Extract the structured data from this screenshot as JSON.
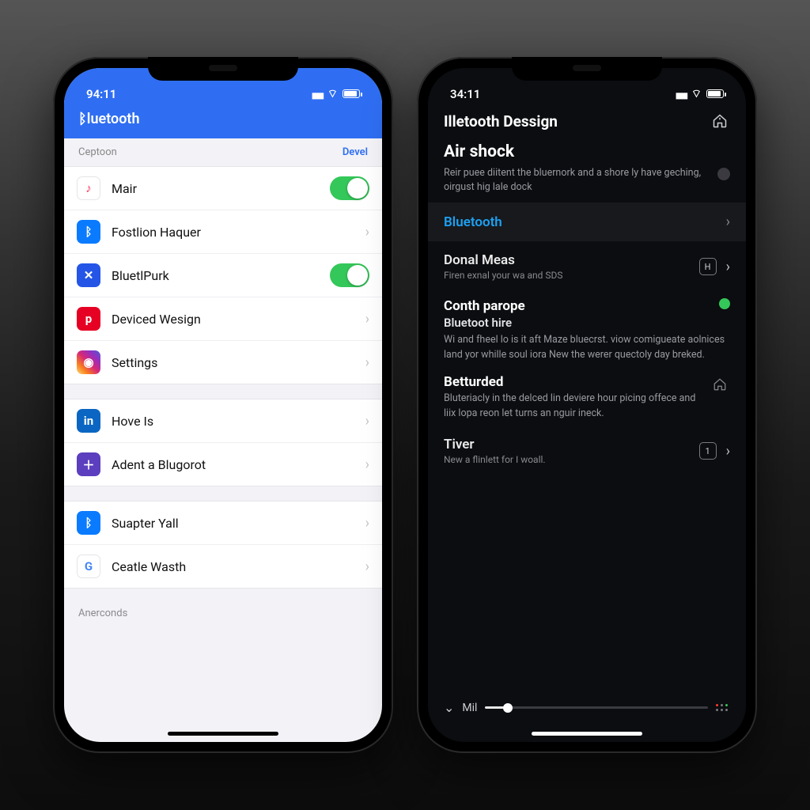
{
  "left": {
    "status": {
      "time": "94:11"
    },
    "header_title": "ᛒluetooth",
    "section_label": "Ceptoon",
    "section_action": "Devel",
    "group1": [
      {
        "label": "Mair",
        "icon": "music-icon",
        "color": "#ffffff",
        "fg": "#fc3158",
        "ctrl": "switch-on"
      },
      {
        "label": "Fostlion Haquer",
        "icon": "bluetooth-icon",
        "color": "#0a7bff",
        "fg": "#fff",
        "ctrl": "chevron"
      },
      {
        "label": "BluetlPurk",
        "icon": "tools-icon",
        "color": "#2455e6",
        "fg": "#fff",
        "ctrl": "switch-on"
      },
      {
        "label": "Deviced Wesign",
        "icon": "pinterest-icon",
        "color": "#e60023",
        "fg": "#fff",
        "ctrl": "chevron"
      },
      {
        "label": "Settings",
        "icon": "instagram-icon",
        "color": "linear-gradient(45deg,#feda75,#fa7e1e,#d62976,#962fbf,#4f5bd5)",
        "fg": "#fff",
        "ctrl": "chevron"
      }
    ],
    "group2": [
      {
        "label": "Hove Is",
        "icon": "linkedin-icon",
        "color": "#0a66c2",
        "fg": "#fff",
        "ctrl": "chevron"
      },
      {
        "label": "Adent a Blugorot",
        "icon": "plus-icon",
        "color": "#5b3fbf",
        "fg": "#fff",
        "ctrl": "chevron"
      }
    ],
    "group3": [
      {
        "label": "Suapter Yall",
        "icon": "bluetooth-icon",
        "color": "#0a7bff",
        "fg": "#fff",
        "ctrl": "chevron"
      },
      {
        "label": "Ceatle Wasth",
        "icon": "google-icon",
        "color": "#ffffff",
        "fg": "#4285f4",
        "ctrl": "chevron"
      }
    ],
    "footer_label": "Anerconds"
  },
  "right": {
    "status": {
      "time": "34:11"
    },
    "header_title": "Illetooth Dessign",
    "airshock": {
      "title": "Air shock",
      "sub": "Reir puee diitent the bluernork and a shore ly have geching, oirgust hig lale dock"
    },
    "bluetooth_row": {
      "label": "Bluetooth"
    },
    "donal": {
      "title": "Donal Meas",
      "sub": "Firen exnal your wa and SDS",
      "badge": "H"
    },
    "conth": {
      "heading": "Conth parope",
      "subheading": "Bluetoot hire",
      "body": "Wi and fheel lo is it aft Maze bluecrst. viow comigueate aolnices land yor whille soul iora New the werer quectoly day breked."
    },
    "betturded": {
      "heading": "Betturded",
      "body": "Bluteriacly in the delced lin deviere hour picing offece and liix lopa reon let turns an nguir ineck."
    },
    "tiver": {
      "heading": "Tiver",
      "sub": "New a flinlett for I woall.",
      "badge": "1"
    },
    "footer": {
      "label": "Mil"
    }
  }
}
